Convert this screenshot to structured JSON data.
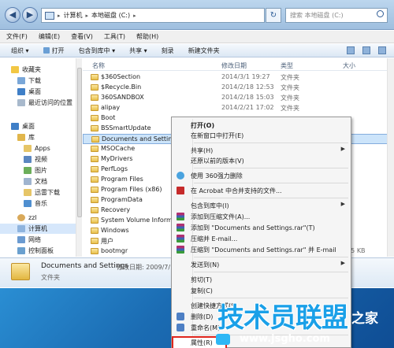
{
  "address": {
    "segments": [
      "计算机",
      "本地磁盘 (C:)"
    ],
    "search_placeholder": "搜索 本地磁盘 (C:)"
  },
  "menubar": [
    "文件(F)",
    "编辑(E)",
    "查看(V)",
    "工具(T)",
    "帮助(H)"
  ],
  "toolbar": [
    "组织 ▾",
    "打开",
    "包含到库中 ▾",
    "共享 ▾",
    "刻录",
    "新建文件夹"
  ],
  "nav": {
    "favorites": "收藏夹",
    "downloads": "下载",
    "desktop_fav": "桌面",
    "recent": "最近访问的位置",
    "desktop": "桌面",
    "libraries": "库",
    "apps": "Apps",
    "videos": "视频",
    "pictures": "图片",
    "documents": "文档",
    "thunder": "迅雷下载",
    "music": "音乐",
    "zzl": "zzl",
    "computer": "计算机",
    "network": "网络",
    "control_panel": "控制面板"
  },
  "columns": {
    "name": "名称",
    "date": "修改日期",
    "type": "类型",
    "size": "大小"
  },
  "files": [
    {
      "name": "$360Section",
      "date": "2014/3/1 19:27",
      "type": "文件夹"
    },
    {
      "name": "$Recycle.Bin",
      "date": "2014/2/18 12:53",
      "type": "文件夹"
    },
    {
      "name": "360SANDBOX",
      "date": "2014/2/18 15:03",
      "type": "文件夹"
    },
    {
      "name": "alipay",
      "date": "2014/2/21 17:02",
      "type": "文件夹"
    },
    {
      "name": "Boot",
      "date": "",
      "type": ""
    },
    {
      "name": "BSSmartUpdate",
      "date": "",
      "type": ""
    },
    {
      "name": "Documents and Settings",
      "date": "",
      "type": ""
    },
    {
      "name": "MSOCache",
      "date": "",
      "type": ""
    },
    {
      "name": "MyDrivers",
      "date": "",
      "type": ""
    },
    {
      "name": "PerfLogs",
      "date": "",
      "type": ""
    },
    {
      "name": "Program Files",
      "date": "",
      "type": ""
    },
    {
      "name": "Program Files (x86)",
      "date": "",
      "type": ""
    },
    {
      "name": "ProgramData",
      "date": "",
      "type": ""
    },
    {
      "name": "Recovery",
      "date": "",
      "type": ""
    },
    {
      "name": "System Volume Informat",
      "date": "",
      "type": ""
    },
    {
      "name": "Windows",
      "date": "",
      "type": ""
    },
    {
      "name": "用户",
      "date": "",
      "type": ""
    },
    {
      "name": "bootmgr",
      "date": "",
      "type": "",
      "size": "375 KB"
    }
  ],
  "details": {
    "name": "Documents and Settings",
    "date": "修改日期: 2009/7/1",
    "type": "文件夹"
  },
  "context_menu": {
    "open": "打开(O)",
    "open_new_window": "在新窗口中打开(E)",
    "share": "共享(H)",
    "restore": "还原以前的版本(V)",
    "force_delete": "使用 360强力删除",
    "acrobat": "在 Acrobat 中合并支持的文件...",
    "include_library": "包含到库中(I)",
    "add_archive": "添加到压缩文件(A)...",
    "add_rar": "添加到 \"Documents and Settings.rar\"(T)",
    "zip_email": "压缩并 E-mail...",
    "rar_email": "压缩到 \"Documents and Settings.rar\" 并 E-mail",
    "send_to": "发送到(N)",
    "cut": "剪切(T)",
    "copy": "复制(C)",
    "create_shortcut": "创建快捷方式(S)",
    "delete": "删除(D)",
    "rename": "重命名(M)",
    "properties": "属性(R)"
  },
  "watermark": {
    "big": "技术员联盟",
    "site": "之家",
    "url": "www.jsgho.com"
  }
}
